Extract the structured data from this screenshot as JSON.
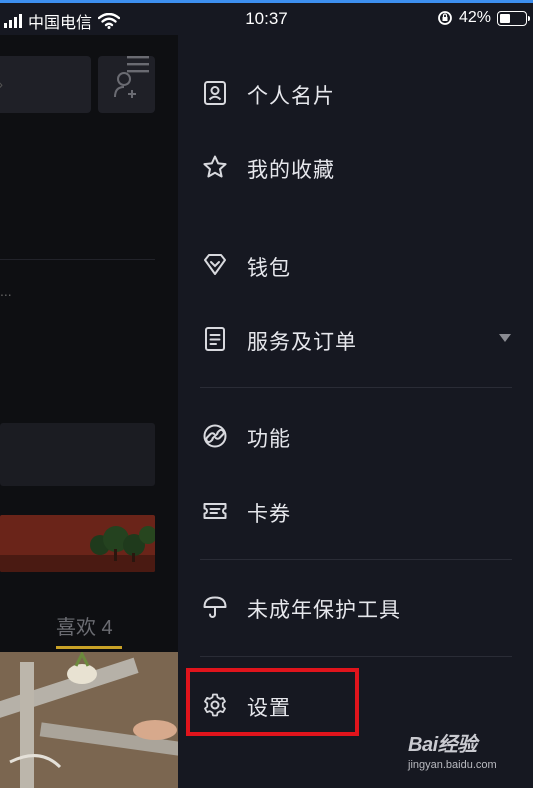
{
  "status_bar": {
    "carrier": "中国电信",
    "time": "10:37",
    "battery_percent": "42%",
    "battery_level": 0.42
  },
  "background": {
    "tab_label": "喜欢 4",
    "dots": "..."
  },
  "drawer": {
    "items": [
      {
        "label": "个人名片",
        "icon": "profile-card-icon"
      },
      {
        "label": "我的收藏",
        "icon": "star-icon"
      },
      {
        "label": "钱包",
        "icon": "wallet-diamond-icon"
      },
      {
        "label": "服务及订单",
        "icon": "document-icon",
        "expandable": true
      },
      {
        "label": "功能",
        "icon": "link-icon"
      },
      {
        "label": "卡券",
        "icon": "ticket-icon"
      },
      {
        "label": "未成年保护工具",
        "icon": "umbrella-icon"
      },
      {
        "label": "设置",
        "icon": "gear-icon"
      }
    ]
  },
  "annotation": {
    "highlight_color": "#e0141c",
    "highlighted_item": "设置"
  },
  "watermark": {
    "brand": "Bai经验",
    "url": "jingyan.baidu.com"
  },
  "colors": {
    "drawer_bg": "#161821",
    "accent_tab": "#c9a227",
    "top_line": "#3d8ff0"
  }
}
